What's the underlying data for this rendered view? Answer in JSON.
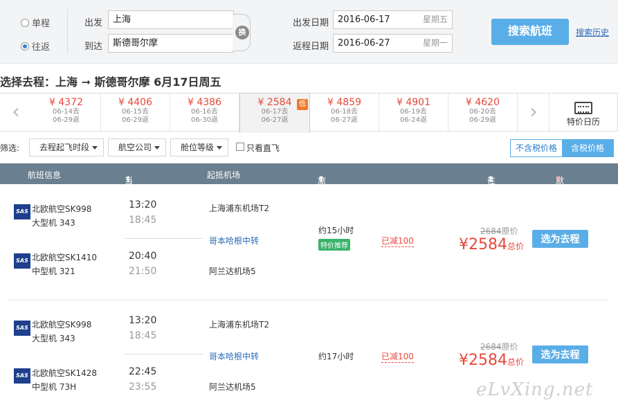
{
  "search": {
    "oneway_label": "单程",
    "roundtrip_label": "往返",
    "from_label": "出发",
    "to_label": "到达",
    "from_value": "上海",
    "to_value": "斯德哥尔摩",
    "swap_label": "换",
    "depart_label": "出发日期",
    "return_label": "返程日期",
    "depart_date": "2016-06-17",
    "depart_weekday": "星期五",
    "return_date": "2016-06-27",
    "return_weekday": "星期一",
    "search_button": "搜索航班",
    "history_link": "搜索历史"
  },
  "heading": "选择去程：上海 ➞ 斯德哥尔摩  6月17日周五",
  "dates": [
    {
      "price": "¥ 4372",
      "d1": "06-14去",
      "d2": "06-29返"
    },
    {
      "price": "¥ 4406",
      "d1": "06-15去",
      "d2": "06-29返"
    },
    {
      "price": "¥ 4386",
      "d1": "06-16去",
      "d2": "06-30返"
    },
    {
      "price": "¥ 2584",
      "d1": "06-17去",
      "d2": "06-27返"
    },
    {
      "price": "¥ 4859",
      "d1": "06-18去",
      "d2": "06-27返"
    },
    {
      "price": "¥ 4901",
      "d1": "06-19去",
      "d2": "06-24返"
    },
    {
      "price": "¥ 4620",
      "d1": "06-20去",
      "d2": "06-29返"
    }
  ],
  "low_badge": "低",
  "calendar_label": "特价日历",
  "filters": {
    "label": "筛选:",
    "time": "去程起飞时段",
    "airline": "航空公司",
    "cabin": "舱位等级",
    "direct": "只看直飞",
    "tax_excluded": "不含税价格",
    "tax_included": "含税价格"
  },
  "columns": {
    "info": "航班信息",
    "time": "当地起降时间",
    "airport": "起抵机场",
    "duration": "旅行总时长",
    "price": "往返 价格",
    "sort": "默认排序"
  },
  "flights": [
    {
      "seg1": {
        "airline": "北欧航空SK998",
        "plane": "大型机 343",
        "dep": "13:20",
        "arr": "18:45",
        "from": "上海浦东机场T2"
      },
      "transfer": "哥本哈根中转",
      "seg2": {
        "airline": "北欧航空SK1410",
        "plane": "中型机 321",
        "dep": "20:40",
        "arr": "21:50",
        "to": "阿兰达机场5"
      },
      "duration": "约15小时",
      "tag": "特价推荐",
      "discount": "已减100",
      "orig_price": "2684",
      "orig_suffix": "原价",
      "price": "¥2584",
      "price_suffix": "总价",
      "button": "选为去程"
    },
    {
      "seg1": {
        "airline": "北欧航空SK998",
        "plane": "大型机 343",
        "dep": "13:20",
        "arr": "18:45",
        "from": "上海浦东机场T2"
      },
      "transfer": "哥本哈根中转",
      "seg2": {
        "airline": "北欧航空SK1428",
        "plane": "中型机 73H",
        "dep": "22:45",
        "arr": "23:55",
        "to": "阿兰达机场5"
      },
      "duration": "约17小时",
      "tag": "",
      "discount": "已减100",
      "orig_price": "2684",
      "orig_suffix": "原价",
      "price": "¥2584",
      "price_suffix": "总价",
      "button": "选为去程"
    }
  ],
  "logo_text": "SAS",
  "watermark": "eLvXing.net"
}
